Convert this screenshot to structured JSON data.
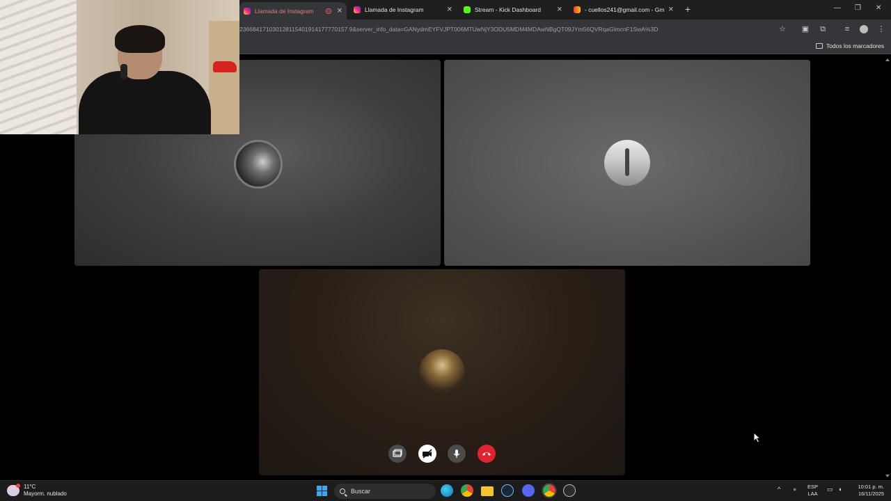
{
  "browser": {
    "tabs": [
      {
        "label": "Llamada de Instagram",
        "icon": "instagram-icon",
        "active": true,
        "recording": true
      },
      {
        "label": "Llamada de Instagram",
        "icon": "instagram-icon",
        "active": false
      },
      {
        "label": "Stream - Kick Dashboard",
        "icon": "kick-icon",
        "active": false
      },
      {
        "label": "- cuellos241@gmail.com - Gm",
        "icon": "gmail-icon",
        "active": false
      }
    ],
    "url": "236684171030128115401914177770157 9&server_info_data=GANydmEYFVJPT006MTUwNjY3ODU5MDM4MDAwNBgQT09JYm56QVRqaGlmcnF1SwA%3D",
    "bookmarks_all": "Todos los marcadores"
  },
  "call": {
    "controls": [
      "screen-share-icon",
      "camera-off-icon",
      "microphone-icon",
      "hang-up-icon"
    ]
  },
  "taskbar": {
    "weather_temp": "11°C",
    "weather_desc": "Mayorm. nublado",
    "search_placeholder": "Buscar",
    "lang_1": "ESP",
    "lang_2": "LAA",
    "time": "10:01 p. m.",
    "date": "16/11/2025"
  },
  "colors": {
    "hangup": "#e0242f",
    "instagram": "#d62976",
    "kick": "#53fc18"
  }
}
